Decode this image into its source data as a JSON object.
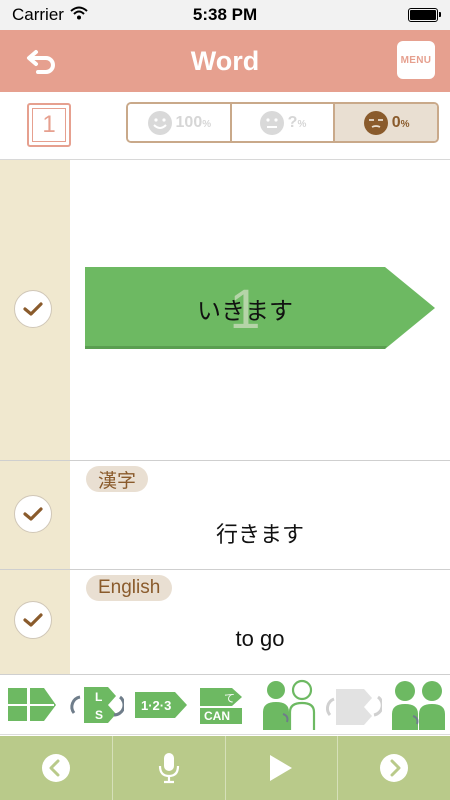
{
  "status": {
    "carrier": "Carrier",
    "time": "5:38 PM"
  },
  "nav": {
    "title": "Word",
    "menu_label": "MENU"
  },
  "toolbar": {
    "card_number": "1",
    "filters": [
      {
        "value": "100",
        "unit": "%",
        "icon": "smile-face-icon",
        "active": false
      },
      {
        "value": "?",
        "unit": "%",
        "icon": "neutral-face-icon",
        "active": false
      },
      {
        "value": "0",
        "unit": "%",
        "icon": "sleepy-face-icon",
        "active": true
      }
    ]
  },
  "card": {
    "word": "いきます",
    "number": "1"
  },
  "kanji": {
    "tag": "漢字",
    "text": "行きます"
  },
  "english": {
    "tag": "English",
    "text": "to go"
  },
  "modes": [
    {
      "label": "L",
      "label2": "S"
    },
    {
      "label": "1·2·3"
    },
    {
      "label": "て",
      "label2": "CAN"
    }
  ],
  "colors": {
    "accent": "#e6a08f",
    "green": "#6db962",
    "gutter": "#f0e8cf",
    "bottom": "#b9ca8a",
    "brown": "#8a5b2c"
  }
}
